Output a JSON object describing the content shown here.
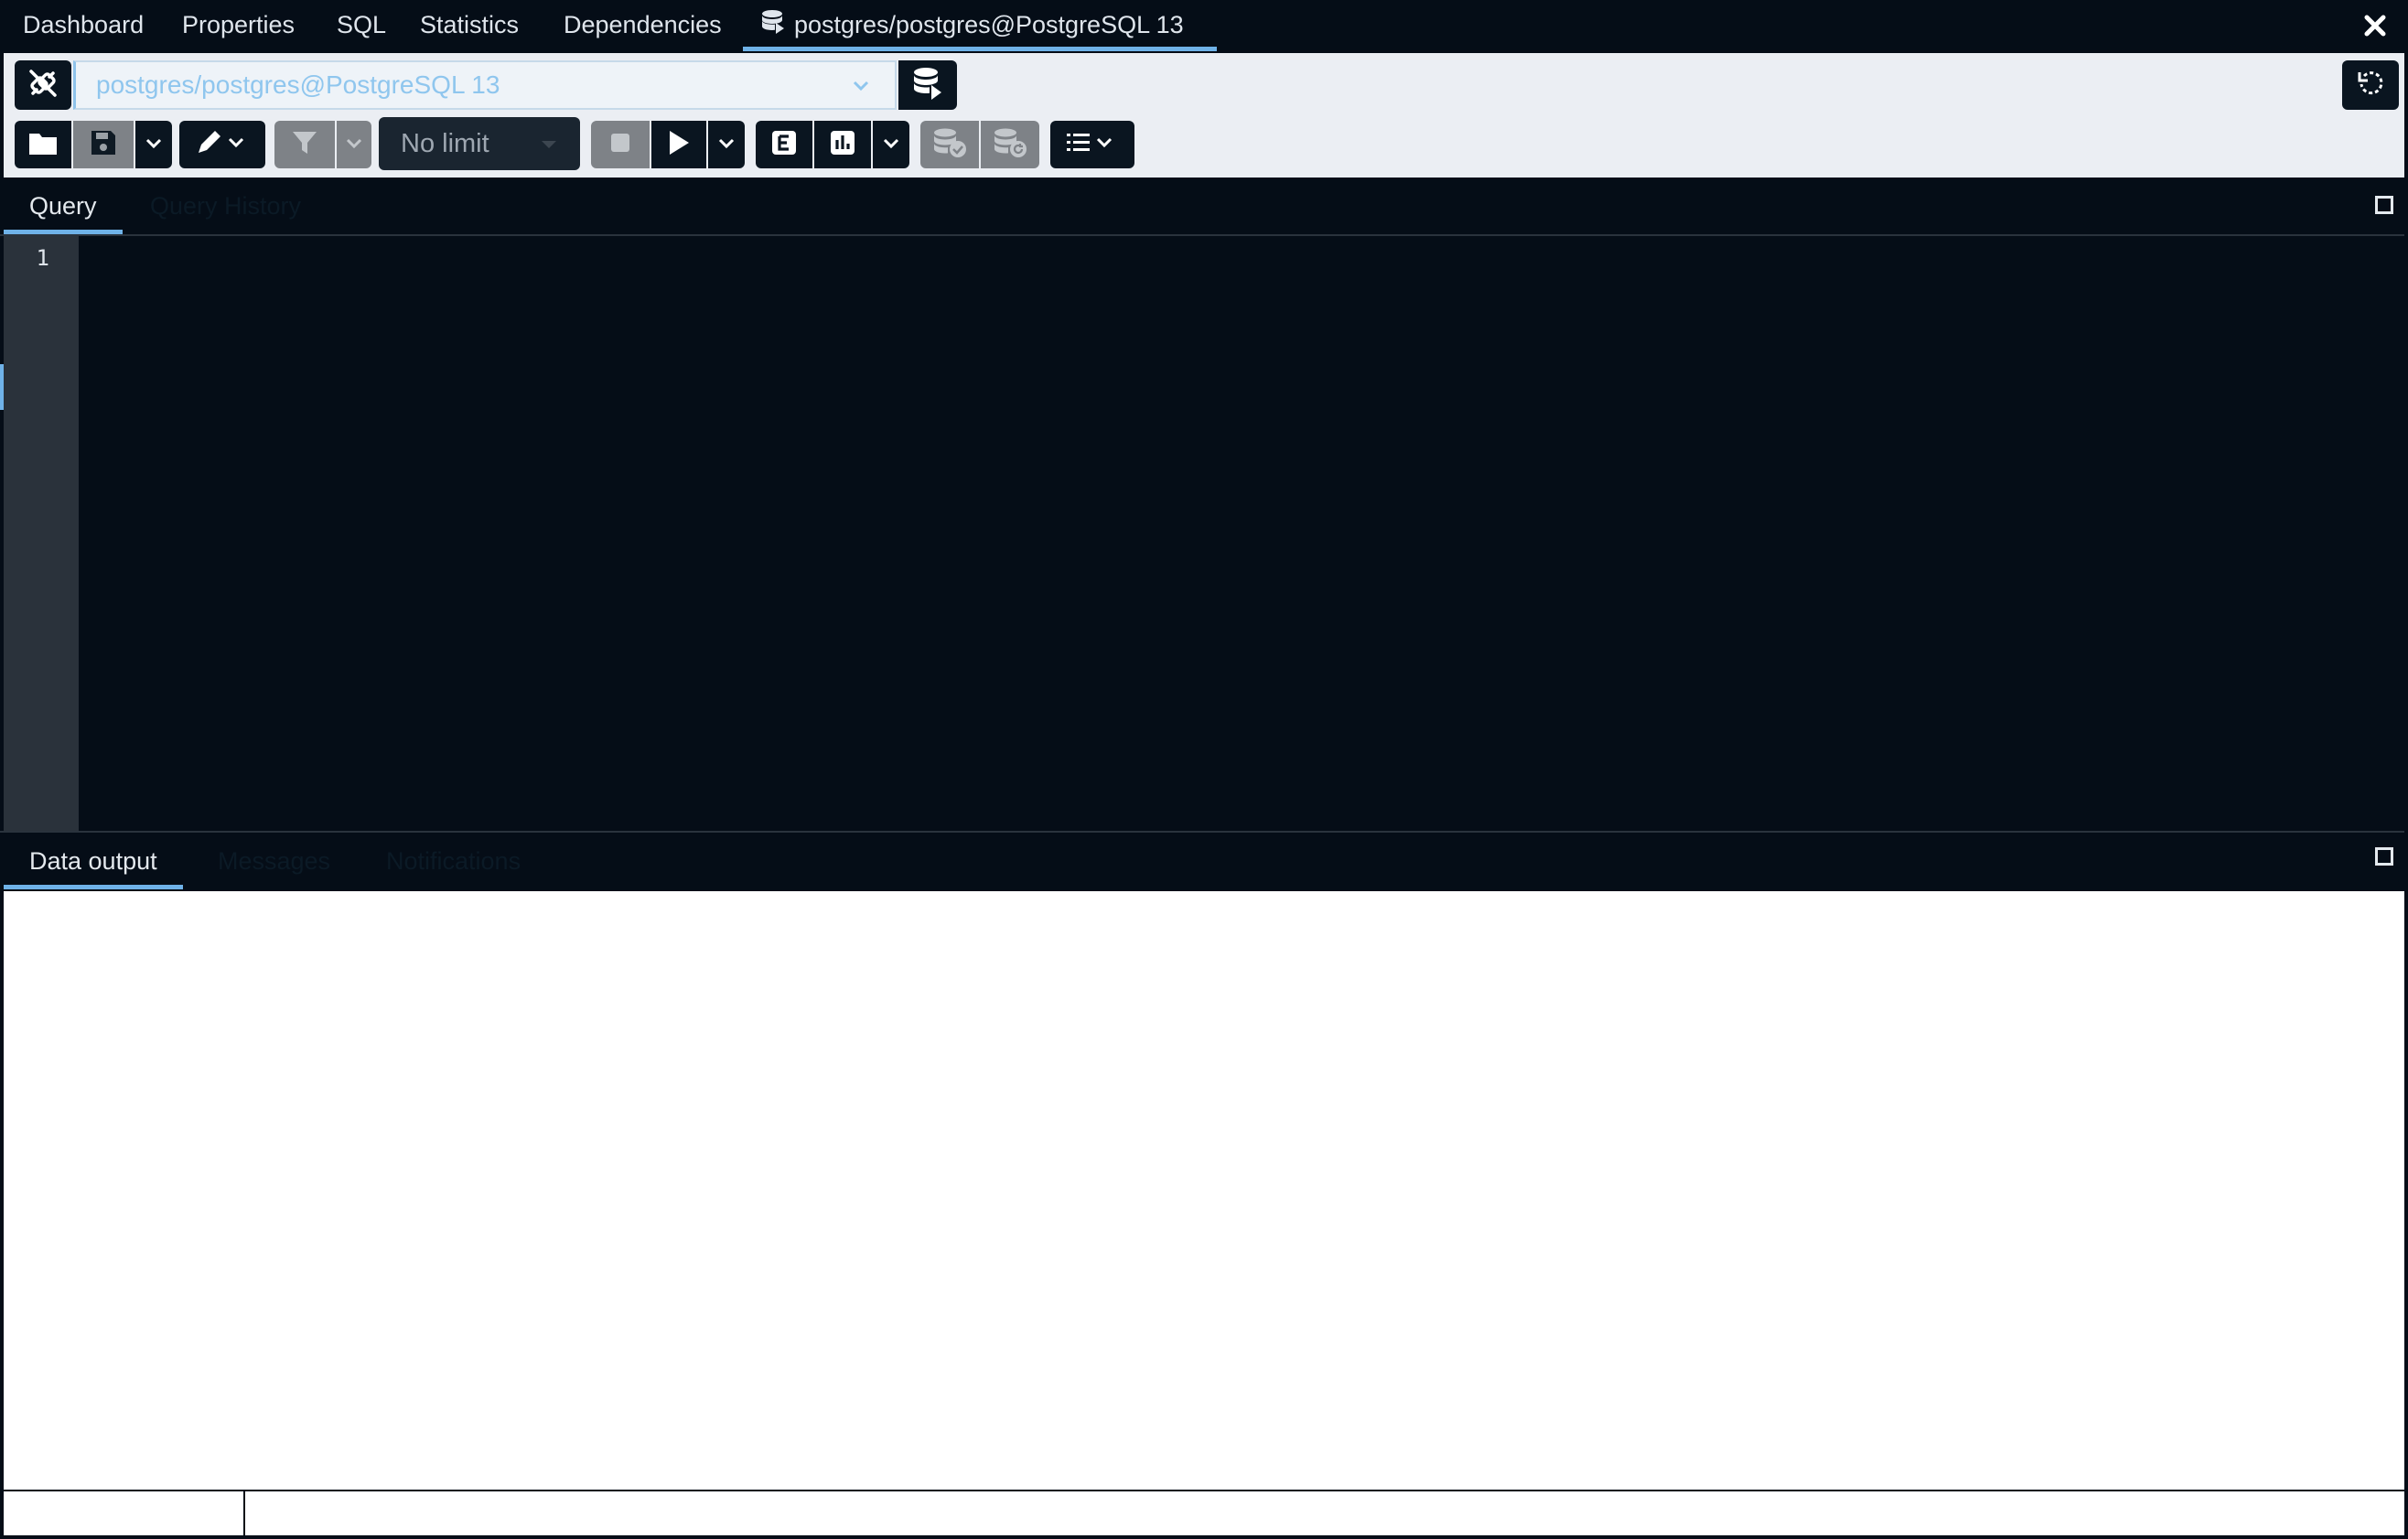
{
  "tabs": [
    {
      "label": "Dashboard"
    },
    {
      "label": "Properties"
    },
    {
      "label": "SQL"
    },
    {
      "label": "Statistics"
    },
    {
      "label": "Dependencies"
    },
    {
      "label": "postgres/postgres@PostgreSQL 13",
      "active": true
    }
  ],
  "toolbar": {
    "connection": "postgres/postgres@PostgreSQL 13",
    "row_limit": "No limit"
  },
  "query_panel": {
    "tabs": [
      "Query",
      "Query History"
    ],
    "active_tab": "Query",
    "line_numbers": [
      "1"
    ]
  },
  "output_panel": {
    "tabs": [
      "Data output",
      "Messages",
      "Notifications"
    ],
    "active_tab": "Data output"
  },
  "colors": {
    "background": "#050d17",
    "accent": "#6fb2e8",
    "toolbar_bg": "#ebeef3",
    "disabled": "#7e8287"
  },
  "icons": [
    "database-icon",
    "close-icon",
    "disconnect-icon",
    "chevron-down-icon",
    "database-new-icon",
    "reset-layout-icon",
    "folder-icon",
    "save-icon",
    "edit-icon",
    "filter-icon",
    "stop-icon",
    "play-icon",
    "explain-icon",
    "explain-analyze-icon",
    "commit-icon",
    "rollback-icon",
    "macros-icon",
    "maximize-icon"
  ]
}
